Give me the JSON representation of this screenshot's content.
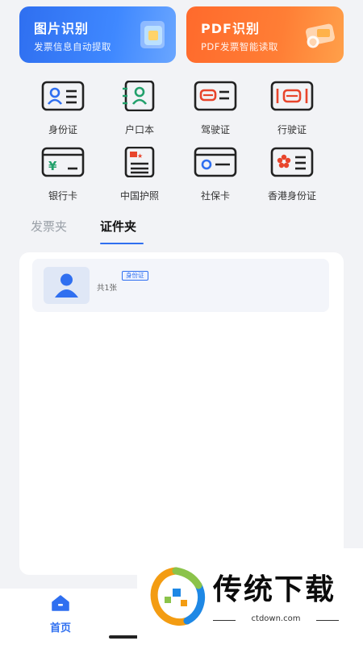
{
  "banners": {
    "image": {
      "title": "图片识别",
      "subtitle": "发票信息自动提取"
    },
    "pdf": {
      "title": "PDF识别",
      "subtitle": "PDF发票智能读取"
    }
  },
  "documents": [
    {
      "label": "身份证",
      "icon": "id-card-icon"
    },
    {
      "label": "户口本",
      "icon": "household-register-icon"
    },
    {
      "label": "驾驶证",
      "icon": "driver-license-icon"
    },
    {
      "label": "行驶证",
      "icon": "vehicle-license-icon"
    },
    {
      "label": "银行卡",
      "icon": "bank-card-icon"
    },
    {
      "label": "中国护照",
      "icon": "passport-icon"
    },
    {
      "label": "社保卡",
      "icon": "social-security-card-icon"
    },
    {
      "label": "香港身份证",
      "icon": "hk-id-card-icon"
    }
  ],
  "tabs": {
    "invoice": "发票夹",
    "certificate": "证件夹",
    "active": "certificate"
  },
  "folder_card": {
    "badge": "身份证",
    "count": "共1张"
  },
  "bottom_nav": {
    "home_label": "首页"
  },
  "watermark": {
    "name": "传统下载",
    "url": "ctdown.com"
  },
  "colors": {
    "accent": "#2f6ff0",
    "orange": "#ff6a2c",
    "icon_red": "#e8452c"
  }
}
